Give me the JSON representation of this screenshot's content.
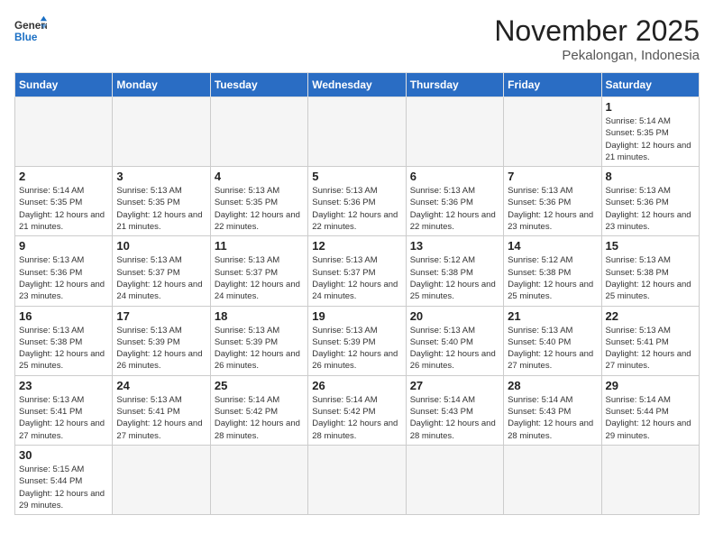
{
  "header": {
    "logo_general": "General",
    "logo_blue": "Blue",
    "month_year": "November 2025",
    "location": "Pekalongan, Indonesia"
  },
  "weekdays": [
    "Sunday",
    "Monday",
    "Tuesday",
    "Wednesday",
    "Thursday",
    "Friday",
    "Saturday"
  ],
  "weeks": [
    [
      {
        "day": "",
        "empty": true
      },
      {
        "day": "",
        "empty": true
      },
      {
        "day": "",
        "empty": true
      },
      {
        "day": "",
        "empty": true
      },
      {
        "day": "",
        "empty": true
      },
      {
        "day": "",
        "empty": true
      },
      {
        "day": "1",
        "sunrise": "Sunrise: 5:14 AM",
        "sunset": "Sunset: 5:35 PM",
        "daylight": "Daylight: 12 hours and 21 minutes."
      }
    ],
    [
      {
        "day": "2",
        "sunrise": "Sunrise: 5:14 AM",
        "sunset": "Sunset: 5:35 PM",
        "daylight": "Daylight: 12 hours and 21 minutes."
      },
      {
        "day": "3",
        "sunrise": "Sunrise: 5:13 AM",
        "sunset": "Sunset: 5:35 PM",
        "daylight": "Daylight: 12 hours and 21 minutes."
      },
      {
        "day": "4",
        "sunrise": "Sunrise: 5:13 AM",
        "sunset": "Sunset: 5:35 PM",
        "daylight": "Daylight: 12 hours and 22 minutes."
      },
      {
        "day": "5",
        "sunrise": "Sunrise: 5:13 AM",
        "sunset": "Sunset: 5:36 PM",
        "daylight": "Daylight: 12 hours and 22 minutes."
      },
      {
        "day": "6",
        "sunrise": "Sunrise: 5:13 AM",
        "sunset": "Sunset: 5:36 PM",
        "daylight": "Daylight: 12 hours and 22 minutes."
      },
      {
        "day": "7",
        "sunrise": "Sunrise: 5:13 AM",
        "sunset": "Sunset: 5:36 PM",
        "daylight": "Daylight: 12 hours and 23 minutes."
      },
      {
        "day": "8",
        "sunrise": "Sunrise: 5:13 AM",
        "sunset": "Sunset: 5:36 PM",
        "daylight": "Daylight: 12 hours and 23 minutes."
      }
    ],
    [
      {
        "day": "9",
        "sunrise": "Sunrise: 5:13 AM",
        "sunset": "Sunset: 5:36 PM",
        "daylight": "Daylight: 12 hours and 23 minutes."
      },
      {
        "day": "10",
        "sunrise": "Sunrise: 5:13 AM",
        "sunset": "Sunset: 5:37 PM",
        "daylight": "Daylight: 12 hours and 24 minutes."
      },
      {
        "day": "11",
        "sunrise": "Sunrise: 5:13 AM",
        "sunset": "Sunset: 5:37 PM",
        "daylight": "Daylight: 12 hours and 24 minutes."
      },
      {
        "day": "12",
        "sunrise": "Sunrise: 5:13 AM",
        "sunset": "Sunset: 5:37 PM",
        "daylight": "Daylight: 12 hours and 24 minutes."
      },
      {
        "day": "13",
        "sunrise": "Sunrise: 5:12 AM",
        "sunset": "Sunset: 5:38 PM",
        "daylight": "Daylight: 12 hours and 25 minutes."
      },
      {
        "day": "14",
        "sunrise": "Sunrise: 5:12 AM",
        "sunset": "Sunset: 5:38 PM",
        "daylight": "Daylight: 12 hours and 25 minutes."
      },
      {
        "day": "15",
        "sunrise": "Sunrise: 5:13 AM",
        "sunset": "Sunset: 5:38 PM",
        "daylight": "Daylight: 12 hours and 25 minutes."
      }
    ],
    [
      {
        "day": "16",
        "sunrise": "Sunrise: 5:13 AM",
        "sunset": "Sunset: 5:38 PM",
        "daylight": "Daylight: 12 hours and 25 minutes."
      },
      {
        "day": "17",
        "sunrise": "Sunrise: 5:13 AM",
        "sunset": "Sunset: 5:39 PM",
        "daylight": "Daylight: 12 hours and 26 minutes."
      },
      {
        "day": "18",
        "sunrise": "Sunrise: 5:13 AM",
        "sunset": "Sunset: 5:39 PM",
        "daylight": "Daylight: 12 hours and 26 minutes."
      },
      {
        "day": "19",
        "sunrise": "Sunrise: 5:13 AM",
        "sunset": "Sunset: 5:39 PM",
        "daylight": "Daylight: 12 hours and 26 minutes."
      },
      {
        "day": "20",
        "sunrise": "Sunrise: 5:13 AM",
        "sunset": "Sunset: 5:40 PM",
        "daylight": "Daylight: 12 hours and 26 minutes."
      },
      {
        "day": "21",
        "sunrise": "Sunrise: 5:13 AM",
        "sunset": "Sunset: 5:40 PM",
        "daylight": "Daylight: 12 hours and 27 minutes."
      },
      {
        "day": "22",
        "sunrise": "Sunrise: 5:13 AM",
        "sunset": "Sunset: 5:41 PM",
        "daylight": "Daylight: 12 hours and 27 minutes."
      }
    ],
    [
      {
        "day": "23",
        "sunrise": "Sunrise: 5:13 AM",
        "sunset": "Sunset: 5:41 PM",
        "daylight": "Daylight: 12 hours and 27 minutes."
      },
      {
        "day": "24",
        "sunrise": "Sunrise: 5:13 AM",
        "sunset": "Sunset: 5:41 PM",
        "daylight": "Daylight: 12 hours and 27 minutes."
      },
      {
        "day": "25",
        "sunrise": "Sunrise: 5:14 AM",
        "sunset": "Sunset: 5:42 PM",
        "daylight": "Daylight: 12 hours and 28 minutes."
      },
      {
        "day": "26",
        "sunrise": "Sunrise: 5:14 AM",
        "sunset": "Sunset: 5:42 PM",
        "daylight": "Daylight: 12 hours and 28 minutes."
      },
      {
        "day": "27",
        "sunrise": "Sunrise: 5:14 AM",
        "sunset": "Sunset: 5:43 PM",
        "daylight": "Daylight: 12 hours and 28 minutes."
      },
      {
        "day": "28",
        "sunrise": "Sunrise: 5:14 AM",
        "sunset": "Sunset: 5:43 PM",
        "daylight": "Daylight: 12 hours and 28 minutes."
      },
      {
        "day": "29",
        "sunrise": "Sunrise: 5:14 AM",
        "sunset": "Sunset: 5:44 PM",
        "daylight": "Daylight: 12 hours and 29 minutes."
      }
    ],
    [
      {
        "day": "30",
        "sunrise": "Sunrise: 5:15 AM",
        "sunset": "Sunset: 5:44 PM",
        "daylight": "Daylight: 12 hours and 29 minutes."
      },
      {
        "day": "",
        "empty": true
      },
      {
        "day": "",
        "empty": true
      },
      {
        "day": "",
        "empty": true
      },
      {
        "day": "",
        "empty": true
      },
      {
        "day": "",
        "empty": true
      },
      {
        "day": "",
        "empty": true
      }
    ]
  ]
}
